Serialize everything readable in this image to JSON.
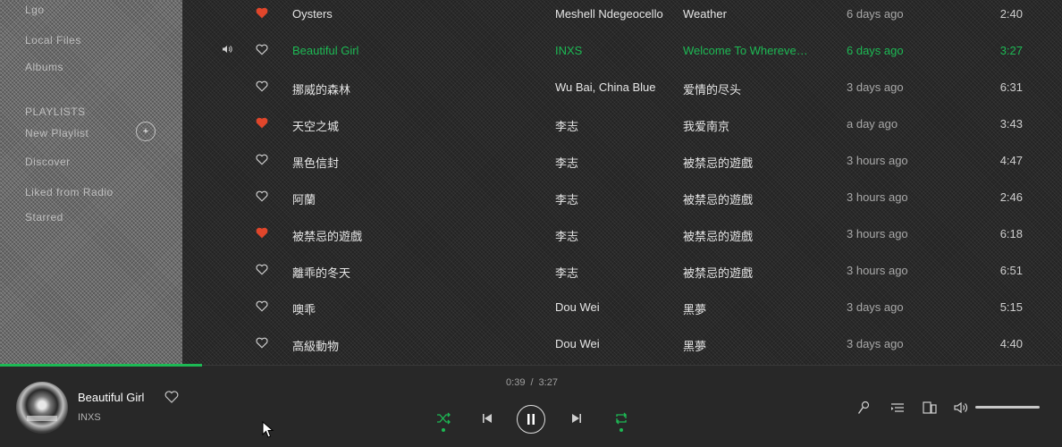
{
  "sidebar": {
    "ghost_labels": [
      "Lgo",
      "Local Files",
      "Albums",
      "PLAYLISTS",
      "New Playlist",
      "Discover",
      "Liked from Radio",
      "Starred"
    ],
    "add_label": "+"
  },
  "tracks": [
    {
      "liked": true,
      "title": "Oysters",
      "artist": "Meshell Ndegeocello",
      "album": "Weather",
      "added": "6 days ago",
      "time": "2:40",
      "playing": false
    },
    {
      "liked": false,
      "title": "Beautiful Girl",
      "artist": "INXS",
      "album": "Welcome To Wherever You Are",
      "added": "6 days ago",
      "time": "3:27",
      "playing": true
    },
    {
      "liked": false,
      "title": "挪威的森林",
      "artist": "Wu Bai, China Blue",
      "album": "爱情的尽头",
      "added": "3 days ago",
      "time": "6:31",
      "playing": false
    },
    {
      "liked": true,
      "title": "天空之城",
      "artist": "李志",
      "album": "我爱南京",
      "added": "a day ago",
      "time": "3:43",
      "playing": false
    },
    {
      "liked": false,
      "title": "黑色信封",
      "artist": "李志",
      "album": "被禁忌的遊戲",
      "added": "3 hours ago",
      "time": "4:47",
      "playing": false
    },
    {
      "liked": false,
      "title": "阿蘭",
      "artist": "李志",
      "album": "被禁忌的遊戲",
      "added": "3 hours ago",
      "time": "2:46",
      "playing": false
    },
    {
      "liked": true,
      "title": "被禁忌的遊戲",
      "artist": "李志",
      "album": "被禁忌的遊戲",
      "added": "3 hours ago",
      "time": "6:18",
      "playing": false
    },
    {
      "liked": false,
      "title": "離乖的冬天",
      "artist": "李志",
      "album": "被禁忌的遊戲",
      "added": "3 hours ago",
      "time": "6:51",
      "playing": false
    },
    {
      "liked": false,
      "title": "噢乖",
      "artist": "Dou Wei",
      "album": "黑夢",
      "added": "3 days ago",
      "time": "5:15",
      "playing": false
    },
    {
      "liked": false,
      "title": "高級動物",
      "artist": "Dou Wei",
      "album": "黑夢",
      "added": "3 days ago",
      "time": "4:40",
      "playing": false
    }
  ],
  "now_playing": {
    "title": "Beautiful Girl",
    "artist": "INXS",
    "elapsed": "0:39",
    "separator": "/",
    "duration": "3:27",
    "progress": 0.19
  },
  "volume": {
    "level": 1.0
  },
  "colors": {
    "accent": "#1db954",
    "liked_heart": "#e0462b",
    "background": "#181818",
    "text": "#e6e6e6"
  },
  "icons": {
    "speaker": "speaker-icon",
    "heart": "heart-icon",
    "shuffle": "shuffle-icon",
    "previous": "skip-back-icon",
    "pause": "pause-icon",
    "next": "skip-forward-icon",
    "repeat": "repeat-icon",
    "lyrics": "microphone-icon",
    "queue": "queue-icon",
    "devices": "devices-icon",
    "volume": "volume-icon"
  }
}
